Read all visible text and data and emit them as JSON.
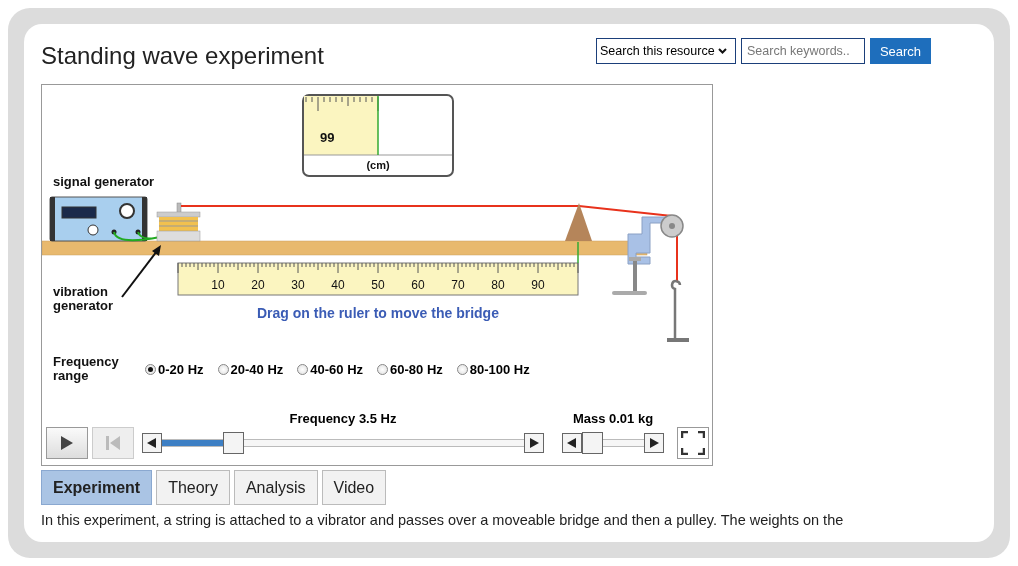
{
  "header": {
    "title": "Standing wave experiment",
    "search_scope": "Search this resource",
    "search": {
      "placeholder": "Search keywords.."
    },
    "search_button": "Search"
  },
  "simulation": {
    "readout": {
      "value": "99",
      "unit": "(cm)"
    },
    "signal_generator_label": "signal generator",
    "vibration_generator_label": "vibration generator",
    "ruler_labels": [
      "10",
      "20",
      "30",
      "40",
      "50",
      "60",
      "70",
      "80",
      "90"
    ],
    "hint": "Drag on the ruler to move the bridge",
    "frequency_range": {
      "label": "Frequency range",
      "options": [
        {
          "label": "0-20 Hz",
          "selected": true
        },
        {
          "label": "20-40 Hz",
          "selected": false
        },
        {
          "label": "40-60 Hz",
          "selected": false
        },
        {
          "label": "60-80 Hz",
          "selected": false
        },
        {
          "label": "80-100 Hz",
          "selected": false
        }
      ]
    },
    "buttons": [
      {
        "kind": "play",
        "disabled": false
      },
      {
        "kind": "reset",
        "disabled": true
      }
    ],
    "frequency": {
      "label": "Frequency 3.5 Hz",
      "level": 0.18
    },
    "mass": {
      "label": "Mass 0.01 kg",
      "level": 0
    }
  },
  "tabs": [
    {
      "label": "Experiment",
      "selected": true
    },
    {
      "label": "Theory",
      "selected": false
    },
    {
      "label": "Analysis",
      "selected": false
    },
    {
      "label": "Video",
      "selected": false
    }
  ],
  "description": "In this experiment, a string is attached to a vibrator and passes over a moveable bridge and then a pulley. The weights on the"
}
